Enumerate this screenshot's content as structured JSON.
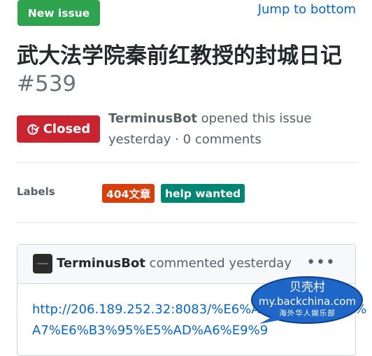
{
  "header": {
    "new_issue_label": "New issue",
    "jump_to_bottom_label": "Jump to bottom"
  },
  "issue": {
    "title": "武大法学院秦前红教授的封城日记",
    "number": "#539",
    "state": "Closed",
    "author": "TerminusBot",
    "opened_text": "opened this issue",
    "time": "yesterday",
    "separator": "·",
    "comments": "0 comments"
  },
  "labels": {
    "heading": "Labels",
    "items": [
      {
        "name": "404文章",
        "color": "#d93f0b"
      },
      {
        "name": "help wanted",
        "color": "#008672"
      }
    ]
  },
  "comment": {
    "author": "TerminusBot",
    "action": "commented yesterday",
    "menu_icon": "kebab-horizontal-icon",
    "body": "http://206.189.252.32:8083/%E6%AD%A6%E5%A4%A7%E6%B3%95%E5%AD%A6%E9%9"
  },
  "watermark": {
    "line1": "贝壳村",
    "line2": "my.backchina.com",
    "line3": "海外华人娱乐部"
  },
  "colors": {
    "green": "#2ea44f",
    "red": "#cb2431",
    "link": "#0366d6",
    "watermark_blue": "#1f66c9"
  }
}
